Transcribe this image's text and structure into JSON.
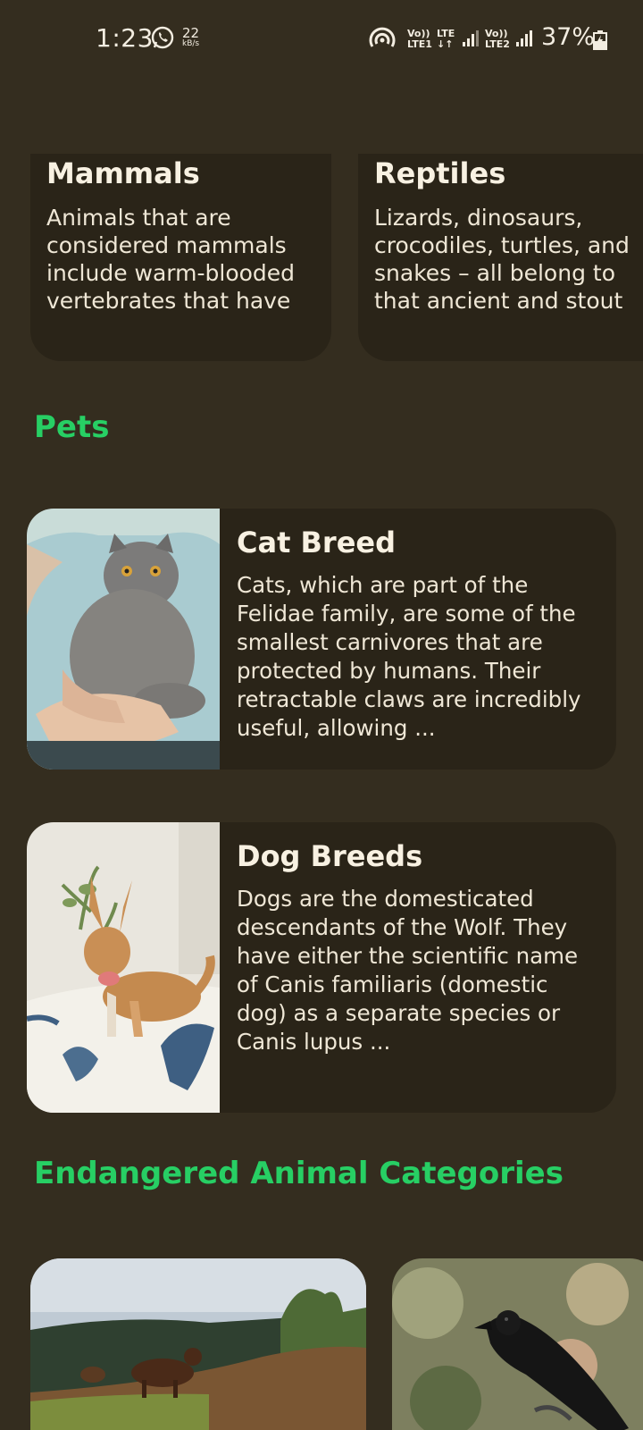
{
  "status_bar": {
    "time": "1:23",
    "speed_value": "22",
    "speed_unit": "kB/s",
    "sim1_top": "Vo))",
    "sim1_bottom": "LTE1",
    "lte_top": "LTE",
    "sim2_top": "Vo))",
    "sim2_bottom": "LTE2",
    "battery": "37%"
  },
  "categories": [
    {
      "title": "Mammals",
      "description": "Animals that are considered mammals include warm-blooded vertebrates that have"
    },
    {
      "title": "Reptiles",
      "description": "Lizards, dinosaurs, crocodiles, turtles, and snakes – all belong to that ancient and stout"
    }
  ],
  "pets_section": {
    "title": "Pets",
    "items": [
      {
        "title": "Cat Breed",
        "description": "Cats, which are part of the Felidae family, are some of the smallest carnivores that are protected by humans. Their retractable claws are incredibly useful, allowing ...",
        "image": "cat-photo"
      },
      {
        "title": "Dog Breeds",
        "description": "Dogs are the domesticated descendants of the Wolf. They have either the scientific name of Canis familiaris (domestic dog) as a separate species or Canis lupus ...",
        "image": "dog-photo"
      }
    ]
  },
  "endangered_section": {
    "title": "Endangered Animal Categories",
    "items": [
      {
        "image": "cattle-photo"
      },
      {
        "image": "crow-photo"
      }
    ]
  },
  "colors": {
    "background": "#342d1f",
    "card": "#2a2418",
    "accent": "#27cf64",
    "text": "#f4ecdc"
  }
}
